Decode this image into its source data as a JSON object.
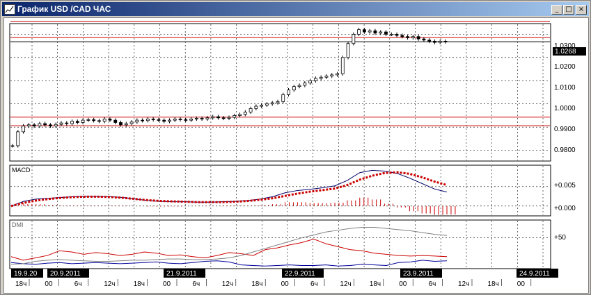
{
  "window": {
    "title": "График USD /CAD  ЧАС",
    "controls": {
      "minimize": "_",
      "maximize": "□",
      "close": "×"
    }
  },
  "panels": {
    "price": {
      "axis_ticks": [
        "0.9800",
        "0.9900",
        "1.0000",
        "1.0100",
        "1.0200",
        "1.0300"
      ],
      "current_price": "1.0268"
    },
    "macd": {
      "label": "MACD",
      "axis_ticks": [
        "+0.000",
        "+0.005"
      ]
    },
    "dmi": {
      "label": "DMI",
      "axis_ticks": [
        "+50"
      ]
    }
  },
  "time_axis": {
    "date_labels": [
      "19.9.20",
      "20.9.2011",
      "21.9.2011",
      "22.9.2011",
      "23.9.2011",
      "24.9.2011"
    ],
    "hour_labels": [
      "18ч",
      "00",
      "6ч",
      "12ч",
      "18ч",
      "00",
      "6ч",
      "12ч",
      "18ч",
      "00",
      "6ч",
      "12ч",
      "18ч",
      "00",
      "6ч",
      "12ч",
      "18ч",
      "00"
    ]
  },
  "colors": {
    "title_bg": "#0a246a",
    "price_line": "#cc0000",
    "macd_signal": "#cc0000",
    "macd_main": "#000066",
    "dmi_plus": "#cc0000",
    "dmi_minus": "#000099",
    "dmi_adx": "#808080"
  },
  "chart_data": [
    {
      "type": "candlestick",
      "title": "",
      "y_ticks": [
        0.98,
        0.99,
        1.0,
        1.01,
        1.02,
        1.03
      ],
      "ylim": [
        0.976,
        1.034
      ],
      "grid": true,
      "horizontal_levels": [
        0.9906,
        0.9943,
        1.0286,
        1.0356
      ],
      "current_value": 1.0268,
      "closes": [
        0.982,
        0.988,
        0.9905,
        0.991,
        0.9905,
        0.9915,
        0.991,
        0.9905,
        0.9912,
        0.9918,
        0.9915,
        0.9925,
        0.992,
        0.993,
        0.9932,
        0.9928,
        0.9925,
        0.9935,
        0.993,
        0.992,
        0.991,
        0.9915,
        0.9922,
        0.993,
        0.9928,
        0.9935,
        0.9932,
        0.993,
        0.9925,
        0.993,
        0.9935,
        0.9932,
        0.993,
        0.9935,
        0.9938,
        0.9935,
        0.994,
        0.9945,
        0.994,
        0.9938,
        0.9942,
        0.995,
        0.9955,
        0.9965,
        0.998,
        0.999,
        0.9995,
        1.0,
        1.0005,
        1.001,
        1.004,
        1.006,
        1.0075,
        1.008,
        1.009,
        1.01,
        1.011,
        1.0115,
        1.012,
        1.0125,
        1.013,
        1.02,
        1.026,
        1.03,
        1.032,
        1.031,
        1.0315,
        1.0305,
        1.031,
        1.03,
        1.03,
        1.0295,
        1.029,
        1.0285,
        1.029,
        1.028,
        1.0275,
        1.027,
        1.0265,
        1.027,
        1.0268
      ]
    },
    {
      "type": "line",
      "title": "",
      "ylim": [
        -0.002,
        0.0098
      ],
      "y_ticks": [
        0.0,
        0.005
      ],
      "series": [
        {
          "values": [
            0.0,
            0.0012,
            0.0018,
            0.002,
            0.0022,
            0.0024,
            0.0025,
            0.0025,
            0.0024,
            0.0022,
            0.0018,
            0.0014,
            0.0012,
            0.0011,
            0.0011,
            0.001,
            0.001,
            0.0011,
            0.0012,
            0.0014,
            0.0018,
            0.0024,
            0.0034,
            0.004,
            0.0043,
            0.0047,
            0.0052,
            0.0066,
            0.0086,
            0.0092,
            0.009,
            0.0084,
            0.0072,
            0.0058,
            0.0044,
            0.0036
          ]
        },
        {
          "values": [
            0.0,
            0.0008,
            0.0014,
            0.0018,
            0.0021,
            0.0023,
            0.0024,
            0.0024,
            0.0023,
            0.0021,
            0.0018,
            0.0015,
            0.0013,
            0.0012,
            0.0011,
            0.001,
            0.001,
            0.001,
            0.0011,
            0.0013,
            0.0016,
            0.002,
            0.0026,
            0.0032,
            0.0037,
            0.0041,
            0.0045,
            0.0054,
            0.0068,
            0.0078,
            0.0085,
            0.0087,
            0.0083,
            0.0074,
            0.0063,
            0.0054
          ]
        }
      ]
    },
    {
      "type": "line",
      "title": "",
      "ylim": [
        0,
        78
      ],
      "y_ticks": [
        50
      ],
      "series": [
        {
          "values": [
            18,
            12,
            16,
            20,
            28,
            26,
            22,
            25,
            23,
            20,
            22,
            26,
            24,
            20,
            21,
            18,
            16,
            20,
            25,
            23,
            20,
            30,
            33,
            38,
            42,
            48,
            40,
            35,
            30,
            28,
            24,
            22,
            20,
            19,
            20,
            19,
            18
          ]
        },
        {
          "values": [
            8,
            6,
            5,
            7,
            8,
            6,
            7,
            8,
            7,
            6,
            7,
            8,
            9,
            7,
            6,
            8,
            10,
            11,
            9,
            4,
            3,
            2,
            3,
            4,
            3,
            3,
            4,
            2,
            3,
            5,
            4,
            3,
            8,
            9,
            12,
            10,
            11
          ]
        },
        {
          "values": [
            5,
            6,
            10,
            12,
            13,
            12,
            11,
            10,
            10,
            11,
            12,
            12,
            13,
            14,
            14,
            13,
            13,
            14,
            16,
            20,
            26,
            32,
            38,
            44,
            50,
            55,
            60,
            63,
            66,
            68,
            68,
            66,
            64,
            62,
            59,
            56,
            54
          ]
        }
      ]
    }
  ]
}
